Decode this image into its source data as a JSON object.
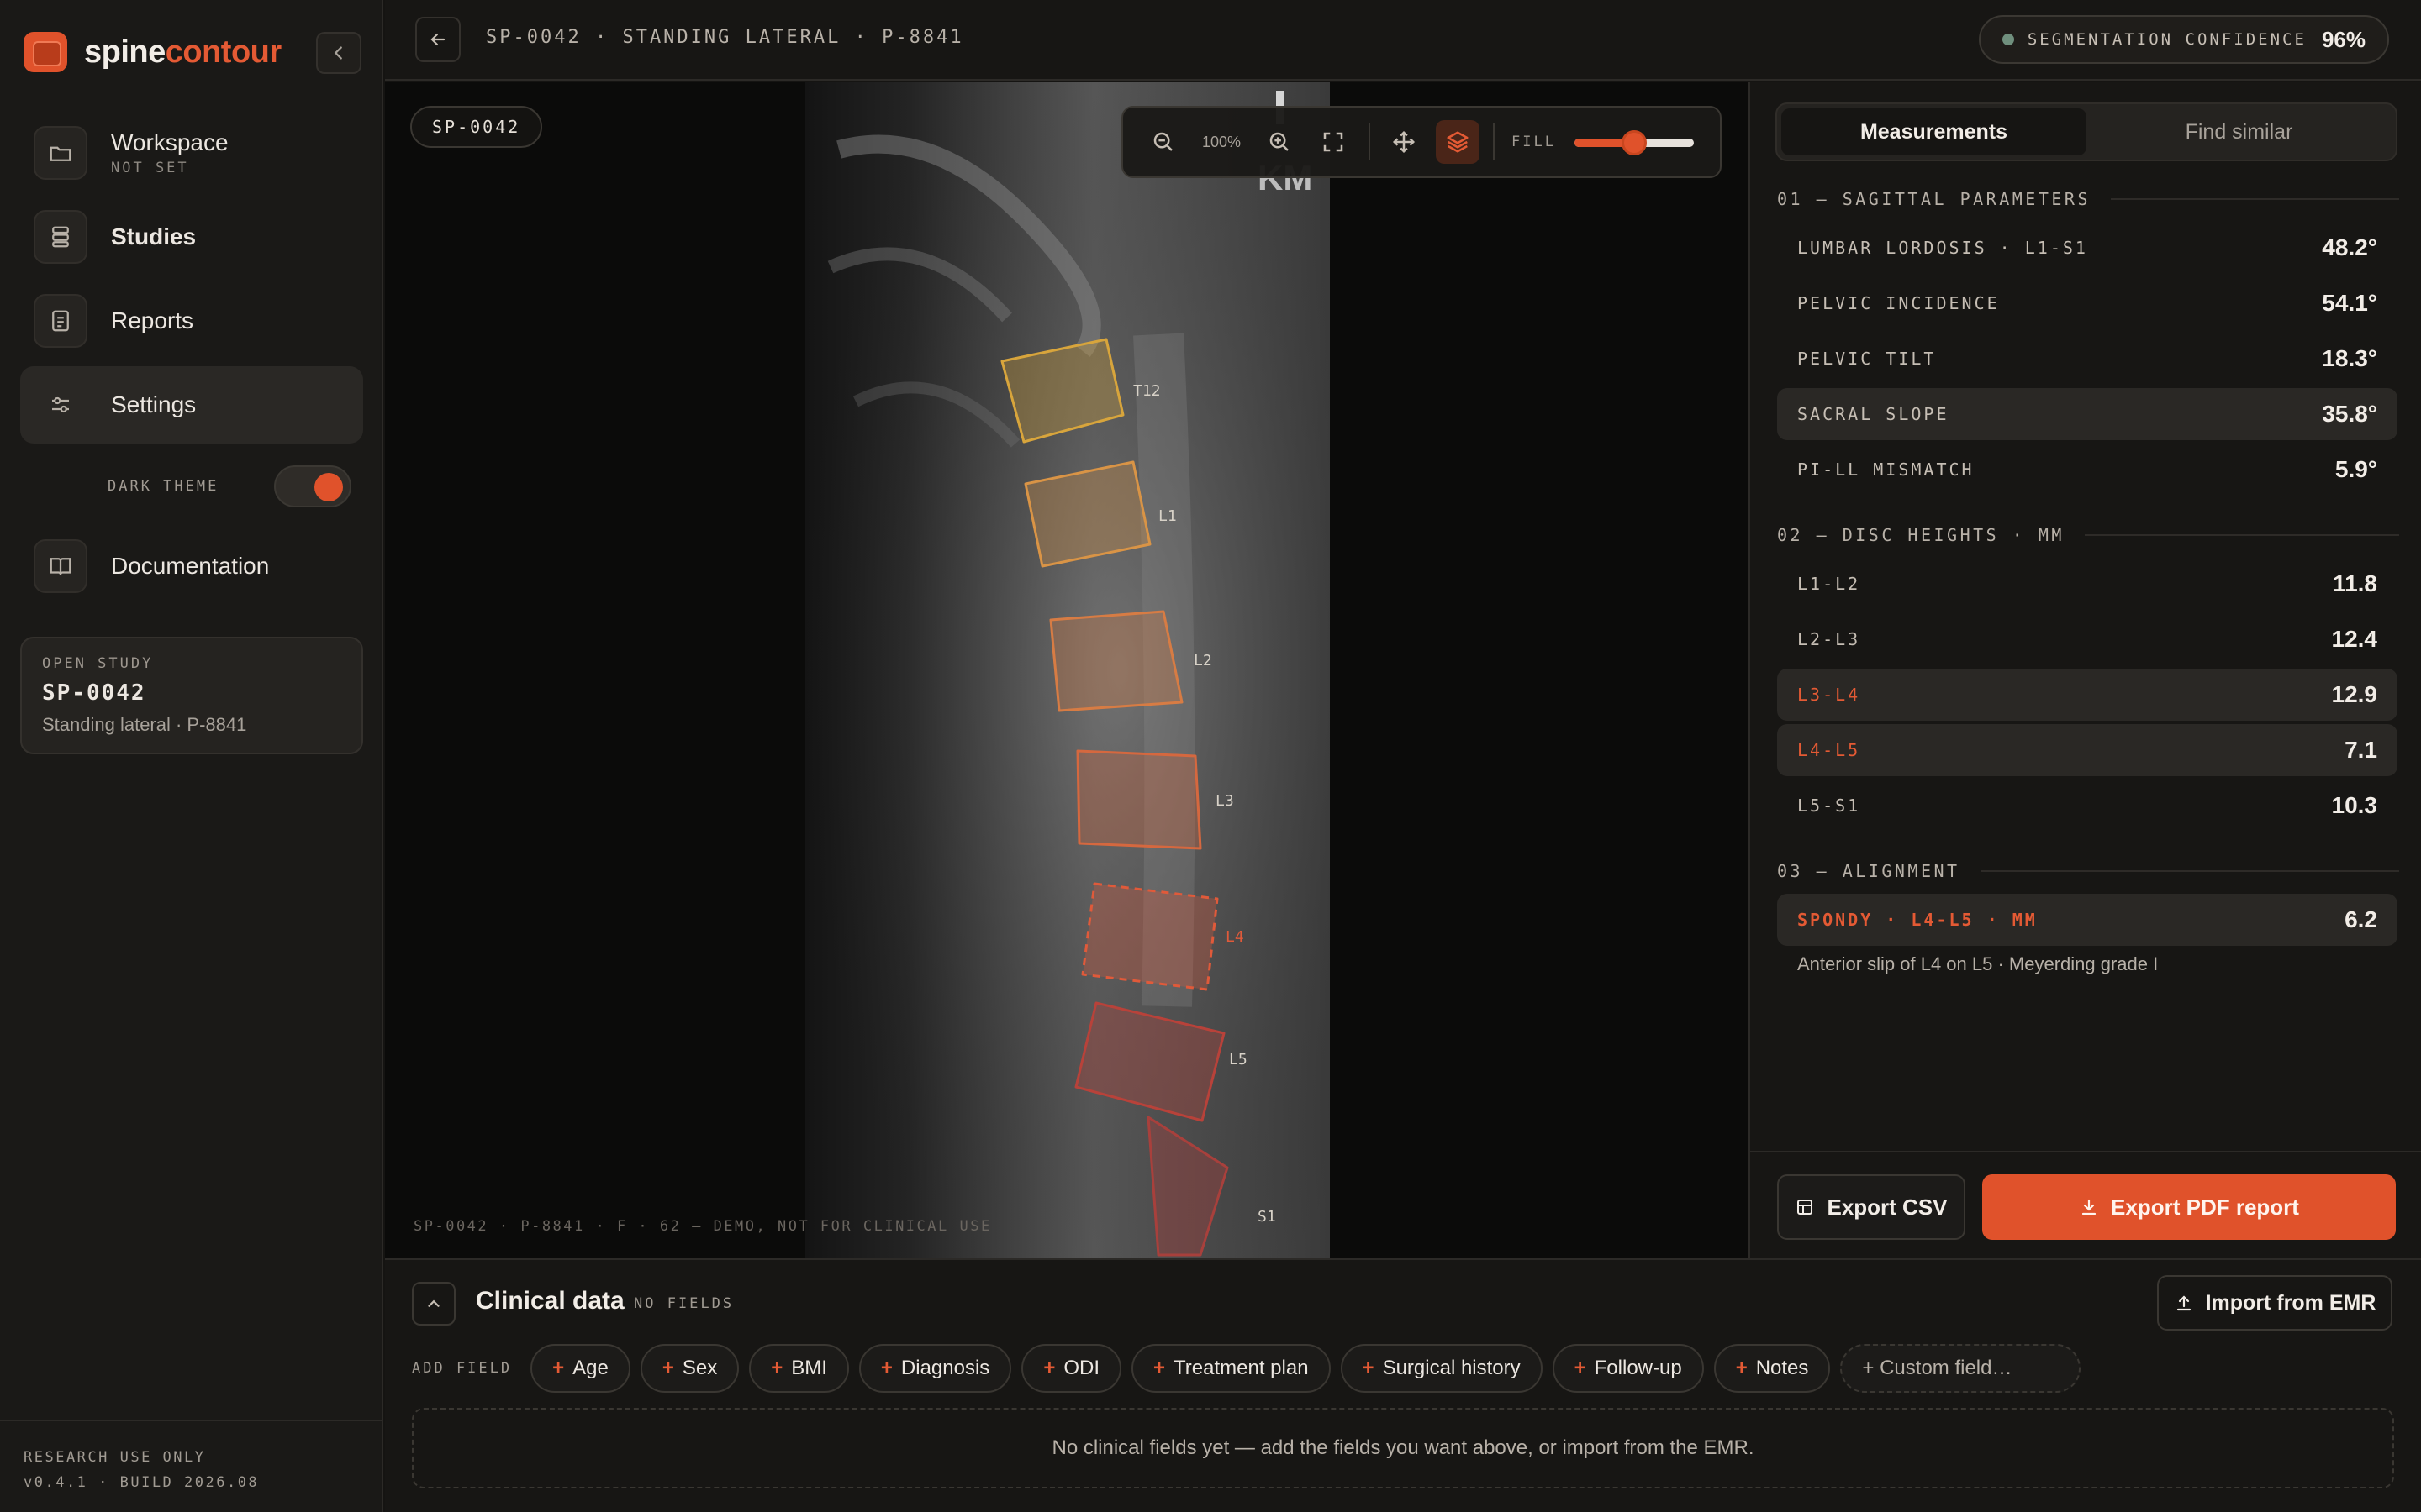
{
  "brand": {
    "part1": "spine",
    "part2": "contour"
  },
  "sidebar": {
    "items": [
      {
        "label": "Workspace",
        "sub": "NOT SET"
      },
      {
        "label": "Studies"
      },
      {
        "label": "Reports"
      },
      {
        "label": "Settings"
      },
      {
        "label": "Documentation"
      }
    ],
    "theme_label": "DARK THEME",
    "theme_on": true,
    "open_study": {
      "kicker": "OPEN STUDY",
      "id": "SP-0042",
      "desc": "Standing lateral · P-8841"
    },
    "footer": {
      "line1": "RESEARCH USE ONLY",
      "line2": "v0.4.1 · BUILD 2026.08"
    }
  },
  "topbar": {
    "breadcrumb": "SP-0042 · STANDING LATERAL · P-8841",
    "confidence_label": "SEGMENTATION CONFIDENCE",
    "confidence_value": "96%"
  },
  "viewer": {
    "study_chip": "SP-0042",
    "zoom": "100%",
    "fill_label": "FILL",
    "fill_value": 0.5,
    "footer": "SP-0042 · P-8841 · F · 62 — DEMO, NOT FOR CLINICAL USE",
    "image_marker": "KM",
    "vertebrae": [
      "T12",
      "L1",
      "L2",
      "L3",
      "L4",
      "L5",
      "S1"
    ],
    "colors": {
      "T12": "#d8a53c",
      "L1": "#d99446",
      "L2": "#d77c44",
      "L3": "#d5683f",
      "L4": "#e05a3a",
      "L5": "#b8423a",
      "S1": "#a8403c"
    }
  },
  "panel": {
    "tabs": [
      "Measurements",
      "Find similar"
    ],
    "sections": {
      "s1": "01 — SAGITTAL PARAMETERS",
      "s2": "02 — DISC HEIGHTS · MM",
      "s3": "03 — ALIGNMENT"
    },
    "sagittal": [
      {
        "label": "LUMBAR LORDOSIS · L1-S1",
        "value": "48.2°"
      },
      {
        "label": "PELVIC INCIDENCE",
        "value": "54.1°"
      },
      {
        "label": "PELVIC TILT",
        "value": "18.3°"
      },
      {
        "label": "SACRAL SLOPE",
        "value": "35.8°"
      },
      {
        "label": "PI-LL MISMATCH",
        "value": "5.9°"
      }
    ],
    "discs": [
      {
        "label": "L1-L2",
        "value": "11.8"
      },
      {
        "label": "L2-L3",
        "value": "12.4"
      },
      {
        "label": "L3-L4",
        "value": "12.9"
      },
      {
        "label": "L4-L5",
        "value": "7.1"
      },
      {
        "label": "L5-S1",
        "value": "10.3"
      }
    ],
    "alignment": {
      "label": "SPONDY · L4-L5 · MM",
      "value": "6.2",
      "note": "Anterior slip of L4 on L5 · Meyerding grade I"
    },
    "export_csv": "Export CSV",
    "export_pdf": "Export PDF report",
    "accent": "#e0522b"
  },
  "clinical": {
    "title": "Clinical data",
    "status": "NO FIELDS",
    "import_label": "Import from EMR",
    "add_field_label": "ADD FIELD",
    "fields": [
      "Age",
      "Sex",
      "BMI",
      "Diagnosis",
      "ODI",
      "Treatment plan",
      "Surgical history",
      "Follow-up",
      "Notes"
    ],
    "custom_field": "+ Custom field…",
    "empty_message": "No clinical fields yet — add the fields you want above, or import from the EMR."
  }
}
